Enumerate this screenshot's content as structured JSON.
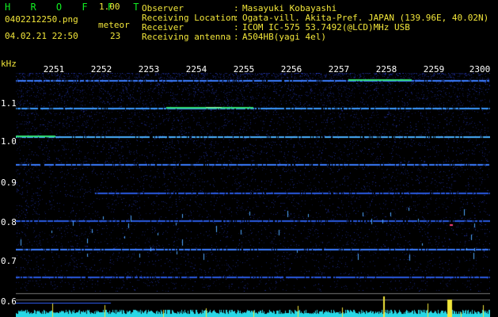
{
  "header": {
    "app_title": "H R O F F T",
    "version": "1.00",
    "filename": "0402212250.png",
    "meteor_label": "meteor",
    "meteor_count": "23",
    "datetime": "04.02.21 22:50",
    "rows": [
      {
        "key": "Observer",
        "sep": ":",
        "value": "Masayuki Kobayashi"
      },
      {
        "key": "Receiving Location",
        "sep": ":",
        "value": "Ogata-vill. Akita-Pref. JAPAN (139.96E, 40.02N)"
      },
      {
        "key": "Receiver",
        "sep": ":",
        "value": "ICOM IC-575 53.7492(@LCD)MHz USB"
      },
      {
        "key": "Receiving antenna",
        "sep": ":",
        "value": "A504HB(yagi 4el)"
      }
    ]
  },
  "axes": {
    "x_ticks": [
      "2251",
      "2252",
      "2253",
      "2254",
      "2255",
      "2256",
      "2257",
      "2258",
      "2259",
      "2300"
    ],
    "y_unit": "kHz",
    "y_ticks": [
      "1.1",
      "1.0",
      "0.9",
      "0.8",
      "0.7",
      "0.6"
    ]
  },
  "colors": {
    "background": "#000000",
    "header_green": "#11ee22",
    "header_yellow": "#f2e63a",
    "noise": "#1b2bb0",
    "trace": "#4a86ff",
    "bottom_bars": "#28d8e6"
  }
}
